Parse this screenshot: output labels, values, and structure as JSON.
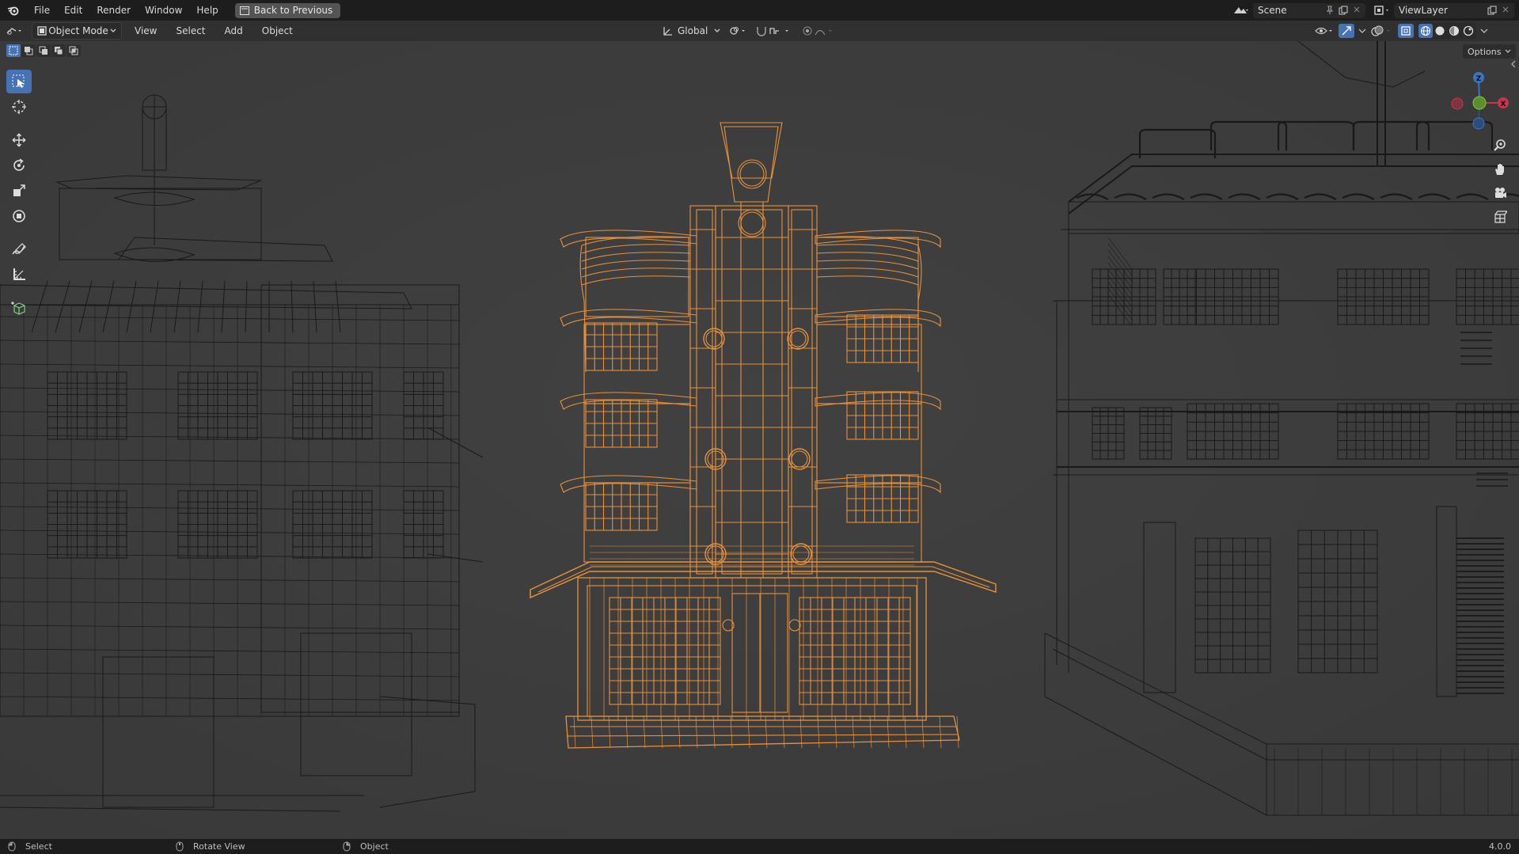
{
  "menubar": {
    "items": [
      "File",
      "Edit",
      "Render",
      "Window",
      "Help"
    ],
    "back_button": "Back to Previous",
    "scene": "Scene",
    "view_layer": "ViewLayer"
  },
  "header": {
    "mode": "Object Mode",
    "menus": [
      "View",
      "Select",
      "Add",
      "Object"
    ],
    "transform_orientation": "Global",
    "options": "Options"
  },
  "toolbar": {
    "tools": [
      "select-box",
      "cursor",
      "move",
      "rotate",
      "scale",
      "transform",
      "annotate",
      "measure",
      "add-cube"
    ]
  },
  "gizmo": {
    "x": "X",
    "y": "Y",
    "z": "Z"
  },
  "status": {
    "items": [
      "Select",
      "Rotate View",
      "Object"
    ],
    "version": "4.0.0"
  },
  "colors": {
    "selected_wire": "#e8913a",
    "wire": "#151515",
    "viewport_bg": "#3d3d3d",
    "accent": "#4772b3"
  }
}
